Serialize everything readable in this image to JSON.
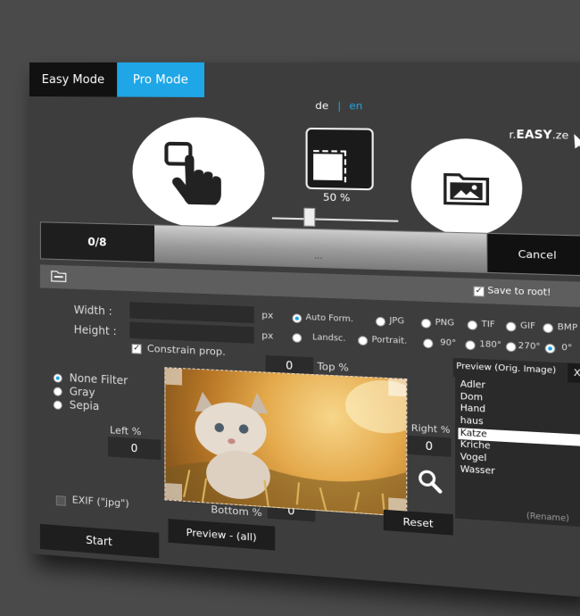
{
  "modes": {
    "easy": "Easy Mode",
    "pro": "Pro Mode"
  },
  "lang": {
    "de": "de",
    "sep": "|",
    "en": "en"
  },
  "brand": {
    "prefix": "r.",
    "name": "EASY",
    "suffix": ".ze"
  },
  "zoom": {
    "label": "50 %",
    "value": 0.3
  },
  "progress": {
    "count": "0/8",
    "status": "...",
    "cancel": "Cancel"
  },
  "save_to_root": {
    "label": "Save to root!",
    "checked": true
  },
  "size": {
    "width_label": "Width :",
    "height_label": "Height :",
    "unit": "px",
    "width_value": "",
    "height_value": ""
  },
  "formats": [
    "Auto Form.",
    "JPG",
    "PNG",
    "TIF",
    "GIF",
    "BMP"
  ],
  "format_selected": "Auto Form.",
  "orientations": [
    "Landsc.",
    "Portrait.",
    "90°",
    "180°",
    "270°",
    "0°"
  ],
  "orientation_selected": "0°",
  "constrain": {
    "label": "Constrain prop.",
    "checked": true
  },
  "filters": [
    "None Filter",
    "Gray",
    "Sepia"
  ],
  "filter_selected": "None Filter",
  "crop": {
    "top_label": "Top %",
    "top": "0",
    "left_label": "Left %",
    "left": "0",
    "right_label": "Right %",
    "right": "0",
    "bottom_label": "Bottom %",
    "bottom": "0"
  },
  "exif": {
    "label": "EXIF (\"jpg\")",
    "checked": false
  },
  "preview_panel": {
    "title": "Preview (Orig. Image)",
    "close": "X",
    "items": [
      "Adler",
      "Dom",
      "Hand",
      "haus",
      "Katze",
      "Kriche",
      "Vogel",
      "Wasser"
    ],
    "selected": "Katze",
    "rename": "(Rename)"
  },
  "buttons": {
    "reset": "Reset",
    "start": "Start",
    "preview_all": "Preview - (all)"
  },
  "colors": {
    "accent": "#1ea6e6",
    "window": "#3d3d3d",
    "dark": "#1e1e1e"
  }
}
